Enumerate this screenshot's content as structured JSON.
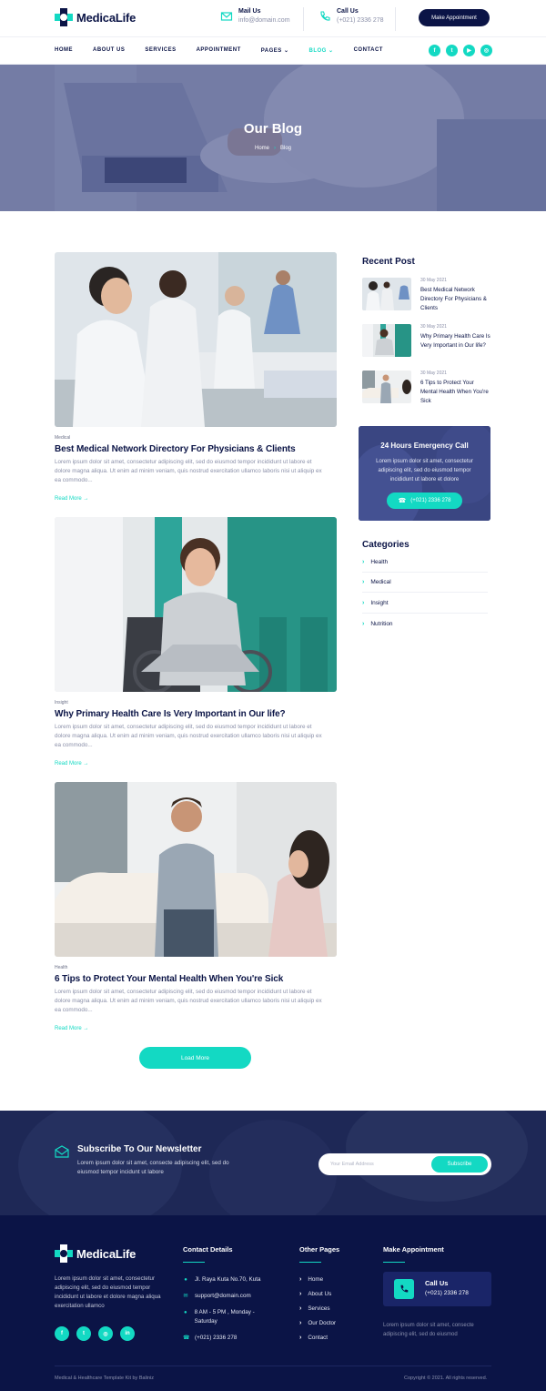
{
  "brand": {
    "name": "MedicaLife"
  },
  "header": {
    "mail_label": "Mail Us",
    "mail_value": "info@domain.com",
    "call_label": "Call Us",
    "call_value": "(+021) 2336 278",
    "appointment_button": "Make Appointment"
  },
  "nav": {
    "items": [
      "HOME",
      "ABOUT US",
      "SERVICES",
      "APPOINTMENT",
      "PAGES",
      "BLOG",
      "CONTACT"
    ],
    "active": "BLOG",
    "socials": [
      "facebook-icon",
      "twitter-icon",
      "youtube-icon",
      "instagram-icon"
    ]
  },
  "hero": {
    "title": "Our Blog",
    "breadcrumb_home": "Home",
    "breadcrumb_separator": "›",
    "breadcrumb_current": "Blog"
  },
  "posts": [
    {
      "category": "Medical",
      "title": "Best Medical Network Directory For Physicians & Clients",
      "excerpt": "Lorem ipsum dolor sit amet, consectetur adipiscing elit, sed do eiusmod tempor incididunt ut labore et dolore magna aliqua. Ut enim ad minim veniam, quis nostrud exercitation ullamco laboris nisi ut aliquip ex ea commodo...",
      "read_more": "Read More →"
    },
    {
      "category": "Insight",
      "title": "Why Primary Health Care Is Very Important in Our life?",
      "excerpt": "Lorem ipsum dolor sit amet, consectetur adipiscing elit, sed do eiusmod tempor incididunt ut labore et dolore magna aliqua. Ut enim ad minim veniam, quis nostrud exercitation ullamco laboris nisi ut aliquip ex ea commodo...",
      "read_more": "Read More →"
    },
    {
      "category": "Health",
      "title": "6 Tips to Protect Your Mental Health When You're Sick",
      "excerpt": "Lorem ipsum dolor sit amet, consectetur adipiscing elit, sed do eiusmod tempor incididunt ut labore et dolore magna aliqua. Ut enim ad minim veniam, quis nostrud exercitation ullamco laboris nisi ut aliquip ex ea commodo...",
      "read_more": "Read More →"
    }
  ],
  "load_more": "Load More",
  "sidebar": {
    "recent_title": "Recent Post",
    "recent": [
      {
        "date": "30 May 2021",
        "title": "Best Medical Network Directory For Physicians & Clients"
      },
      {
        "date": "30 May 2021",
        "title": "Why Primary Health Care Is Very Important in Our life?"
      },
      {
        "date": "30 May 2021",
        "title": "6 Tips to Protect Your Mental Health When You're Sick"
      }
    ],
    "emergency": {
      "title": "24 Hours Emergency Call",
      "text": "Lorem ipsum dolor sit amet, consectetur adipiscing elit, sed do eiusmod tempor incididunt ut labore et dolore",
      "button": "(+021) 2336 278"
    },
    "categories_title": "Categories",
    "categories": [
      "Health",
      "Medical",
      "Insight",
      "Nutrition"
    ]
  },
  "newsletter": {
    "title": "Subscribe To Our Newsletter",
    "text": "Lorem ipsum dolor sit amet, consecte adipiscing elit, sed do eiusmod tempor incidunt ut labore",
    "placeholder": "Your Email Address",
    "button": "Subscribe"
  },
  "footer": {
    "about": "Lorem ipsum dolor sit amet, consectetur adipiscing elit, sed do eiusmod tempor incididunt ut labore et dolore magna aliqua exercitation ullamco",
    "socials": [
      "facebook-icon",
      "twitter-icon",
      "instagram-icon",
      "linkedin-icon"
    ],
    "contact_title": "Contact Details",
    "contact": {
      "address": "Jl. Raya Kuta No.70, Kuta",
      "email": "support@domain.com",
      "hours": "8 AM - 5 PM , Monday - Saturday",
      "phone": "(+021) 2336 278"
    },
    "pages_title": "Other Pages",
    "pages": [
      "Home",
      "About Us",
      "Services",
      "Our Doctor",
      "Contact"
    ],
    "appointment_title": "Make Appointment",
    "call_label": "Call Us",
    "call_value": "(+021) 2336 278",
    "note": "Lorem ipsum dolor sit amet, consecte adipiscing elit, sed do eiusmod",
    "credit": "Medical & Healthcare Template Kit by Baliniz",
    "copyright": "Copyright © 2021. All rights reserved."
  },
  "colors": {
    "accent": "#13d9c3",
    "navy": "#0b1446"
  }
}
